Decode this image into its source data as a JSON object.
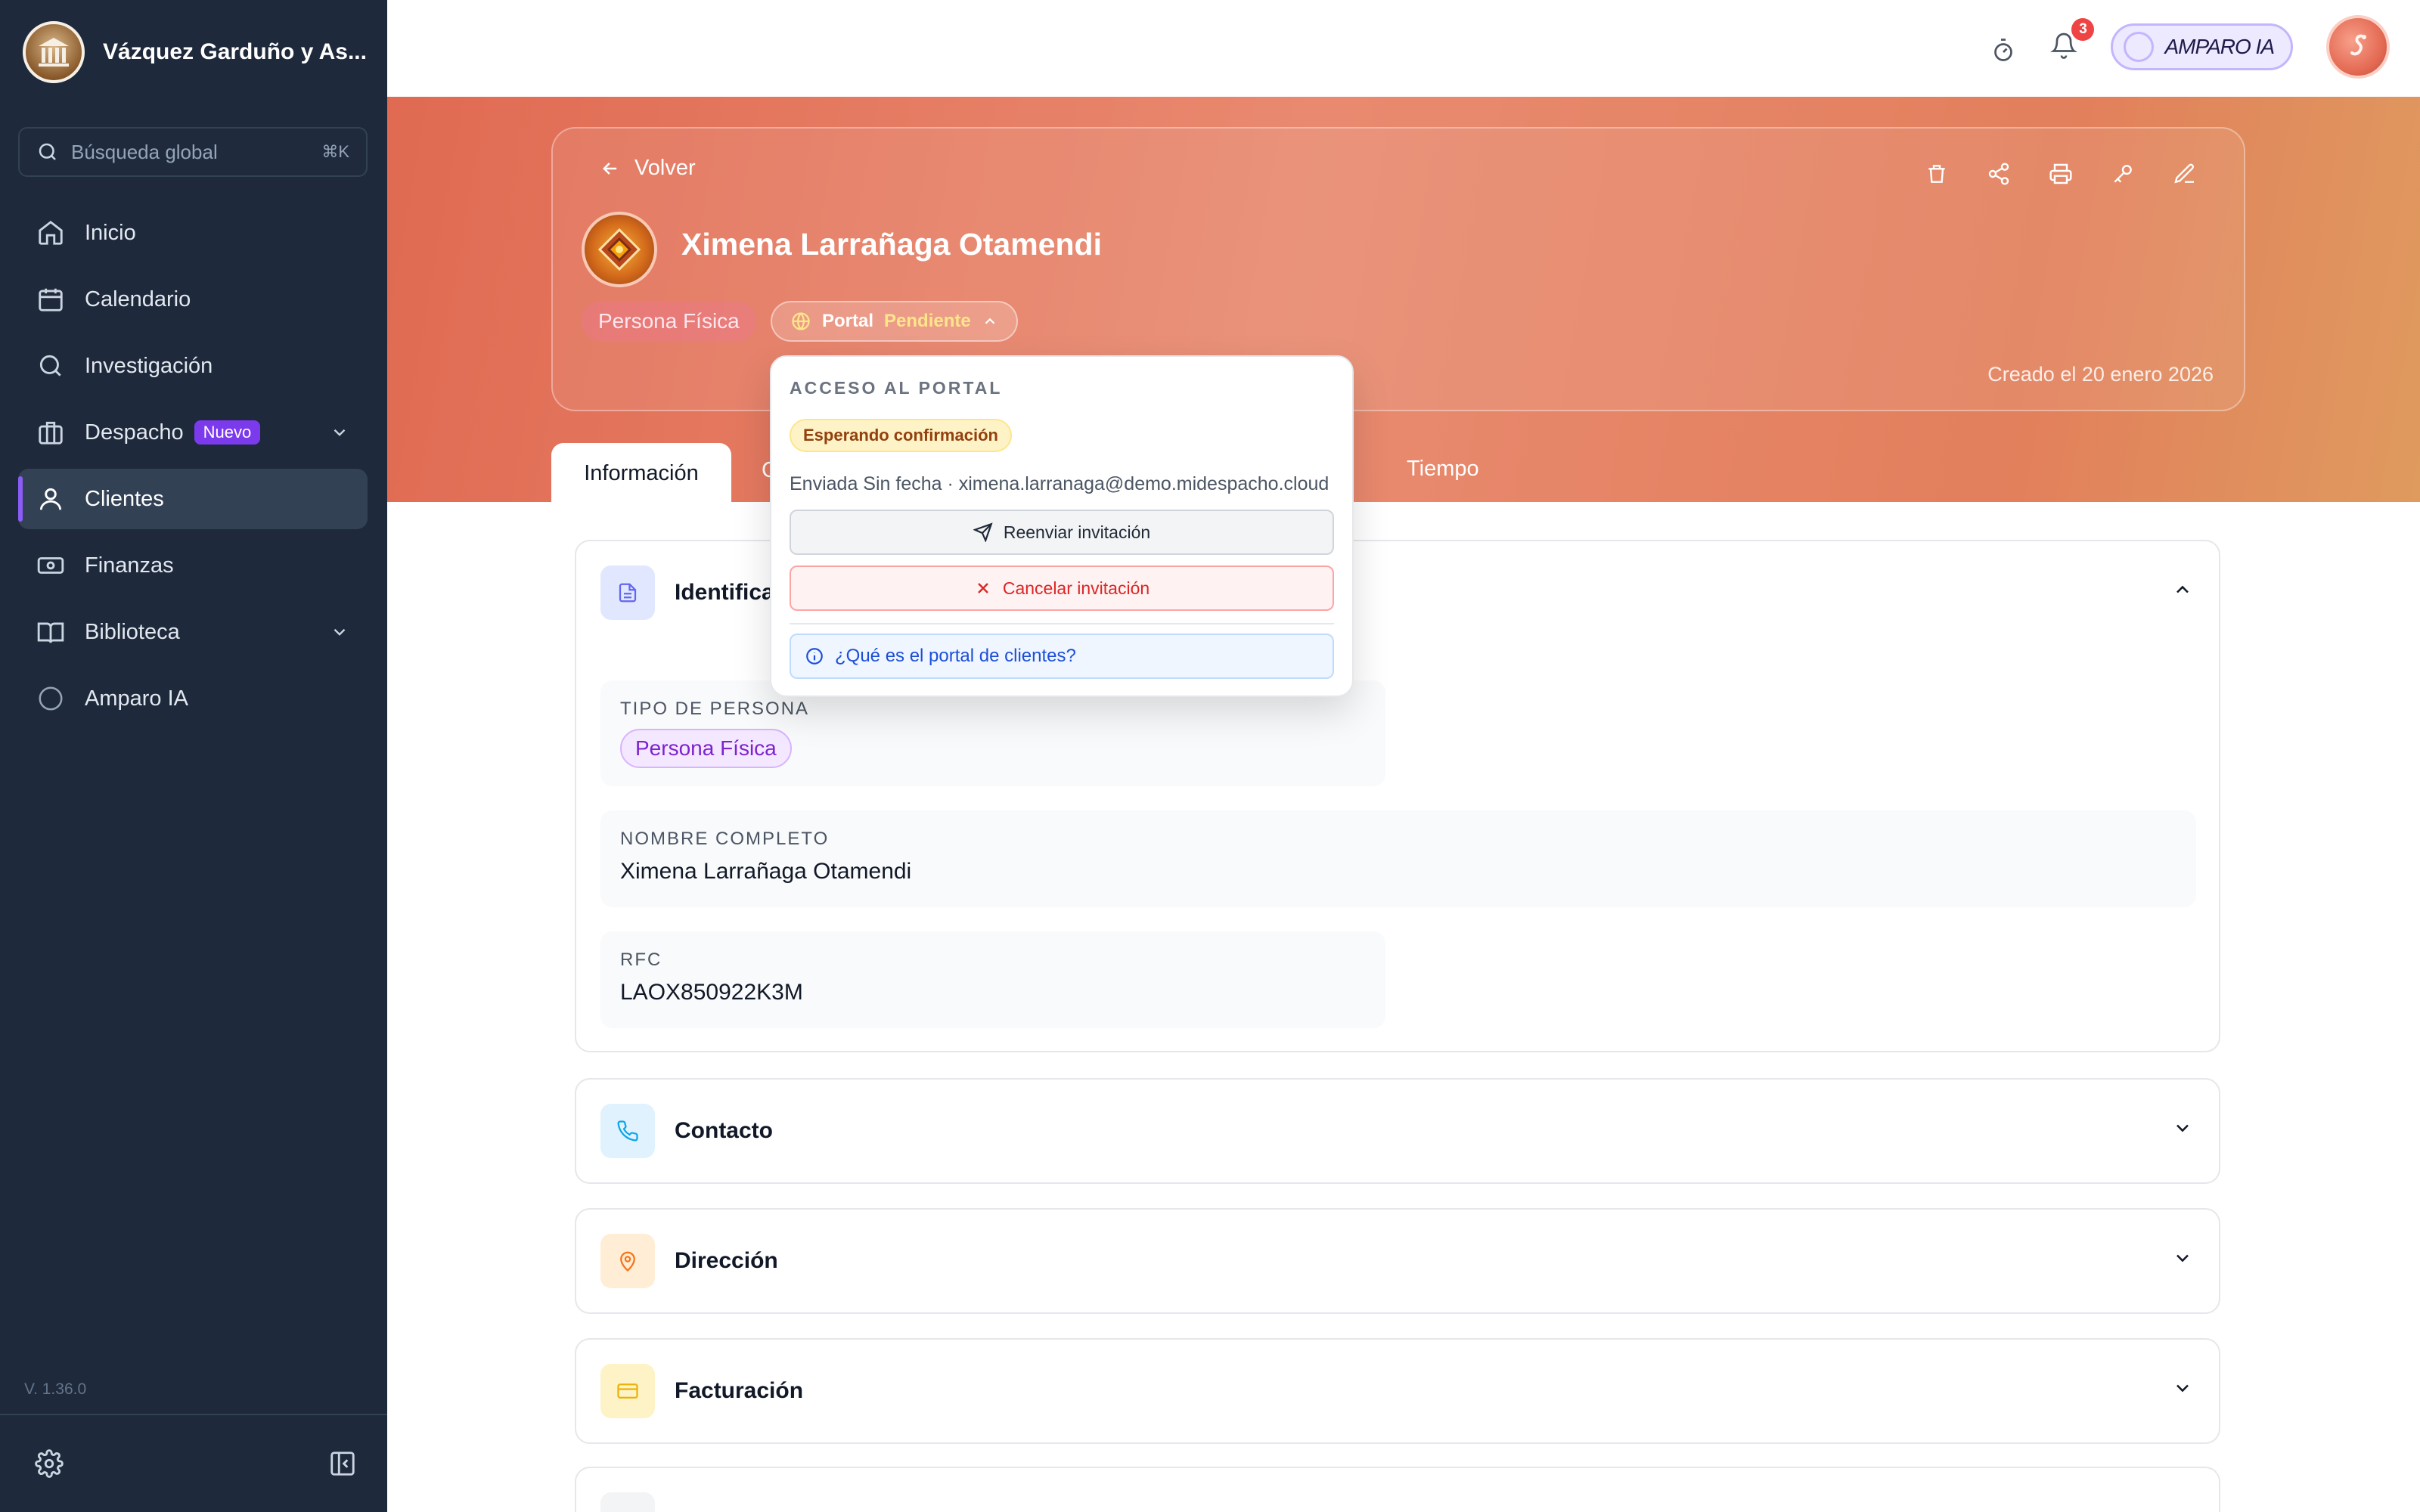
{
  "sidebar": {
    "firm_name": "Vázquez Garduño y As...",
    "search_placeholder": "Búsqueda global",
    "search_shortcut": "⌘K",
    "items": [
      {
        "label": "Inicio",
        "icon": "home-icon"
      },
      {
        "label": "Calendario",
        "icon": "calendar-icon"
      },
      {
        "label": "Investigación",
        "icon": "search-icon"
      },
      {
        "label": "Despacho",
        "badge": "Nuevo",
        "icon": "briefcase-icon",
        "expandable": true
      },
      {
        "label": "Clientes",
        "icon": "user-icon",
        "active": true
      },
      {
        "label": "Finanzas",
        "icon": "money-icon"
      },
      {
        "label": "Biblioteca",
        "icon": "book-icon",
        "expandable": true
      },
      {
        "label": "Amparo IA",
        "icon": "ai-circle-icon"
      }
    ],
    "version": "V. 1.36.0"
  },
  "topbar": {
    "notification_count": "3",
    "ai_label": "AMPARO IA"
  },
  "client": {
    "back_label": "Volver",
    "name": "Ximena Larrañaga Otamendi",
    "tipo_chip": "Persona Física",
    "portal_label": "Portal",
    "portal_status": "Pendiente",
    "created": "Creado el 20 enero 2026"
  },
  "tabs": {
    "active": "Información",
    "partial": "C",
    "time": "Tiempo"
  },
  "popover": {
    "title": "ACCESO AL PORTAL",
    "status": "Esperando confirmación",
    "sent": "Enviada Sin fecha · ximena.larranaga@demo.midespacho.cloud",
    "resend": "Reenviar invitación",
    "cancel": "Cancelar invitación",
    "info": "¿Qué es el portal de clientes?"
  },
  "sections": {
    "identificacion": {
      "title": "Identifica",
      "tipo_label": "TIPO DE PERSONA",
      "tipo_value": "Persona Física",
      "nombre_label": "NOMBRE COMPLETO",
      "nombre_value": "Ximena Larrañaga Otamendi",
      "rfc_label": "RFC",
      "rfc_value": "LAOX850922K3M"
    },
    "contacto": "Contacto",
    "direccion": "Dirección",
    "facturacion": "Facturación"
  },
  "colors": {
    "sidebar_bg": "#1e293b",
    "accent": "#8b5cf6",
    "hero_gradient_start": "#e06a52",
    "hero_gradient_end": "#df9a5e",
    "pending": "#fde68a",
    "danger": "#dc2626"
  }
}
